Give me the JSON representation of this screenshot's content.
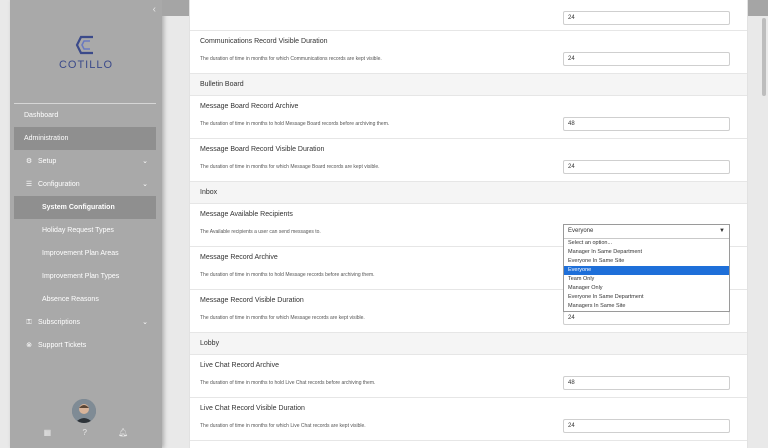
{
  "sidebar": {
    "logo_text": "COTILLO",
    "items": [
      {
        "label": "Dashboard"
      },
      {
        "label": "Administration"
      },
      {
        "label": "Setup"
      },
      {
        "label": "Configuration"
      },
      {
        "label": "System Configuration"
      },
      {
        "label": "Holiday Request Types"
      },
      {
        "label": "Improvement Plan Areas"
      },
      {
        "label": "Improvement Plan Types"
      },
      {
        "label": "Absence Reasons"
      },
      {
        "label": "Subscriptions"
      },
      {
        "label": "Support Tickets"
      }
    ]
  },
  "main": {
    "top_value": "24",
    "settings": {
      "comm_visible": {
        "title": "Communications Record Visible Duration",
        "desc": "The duration of time in months for which Communications records are kept visible.",
        "value": "24"
      },
      "mb_archive": {
        "title": "Message Board Record Archive",
        "desc": "The duration of time in months to hold Message Board records before archiving them.",
        "value": "48"
      },
      "mb_visible": {
        "title": "Message Board Record Visible Duration",
        "desc": "The duration of time in months for which Message Board records are kept visible.",
        "value": "24"
      },
      "msg_recipients": {
        "title": "Message Available Recipients",
        "desc": "The Available recipients a user can send messages to.",
        "value": "Everyone"
      },
      "msg_archive": {
        "title": "Message Record Archive",
        "desc": "The duration of time in months to hold Message records before archiving them."
      },
      "msg_visible": {
        "title": "Message Record Visible Duration",
        "desc": "The duration of time in months for which Message records are kept visible.",
        "value": "24"
      },
      "lc_archive": {
        "title": "Live Chat Record Archive",
        "desc": "The duration of time in months to hold Live Chat records before archiving them.",
        "value": "48"
      },
      "lc_visible": {
        "title": "Live Chat Record Visible Duration",
        "desc": "The duration of time in months for which Live Chat records are kept visible.",
        "value": "24"
      }
    },
    "sections": {
      "bulletin": "Bulletin Board",
      "inbox": "Inbox",
      "lobby": "Lobby"
    },
    "dropdown_options": [
      "Select an option...",
      "Manager In Same Department",
      "Everyone In Same Site",
      "Everyone",
      "Team Only",
      "Manager Only",
      "Everyone In Same Department",
      "Managers In Same Site"
    ]
  },
  "colors": {
    "accent": "#1e6fd9",
    "sidebar": "#a9a9a9",
    "active_nav": "#8f8f8f",
    "logo": "#3b4a8a"
  }
}
